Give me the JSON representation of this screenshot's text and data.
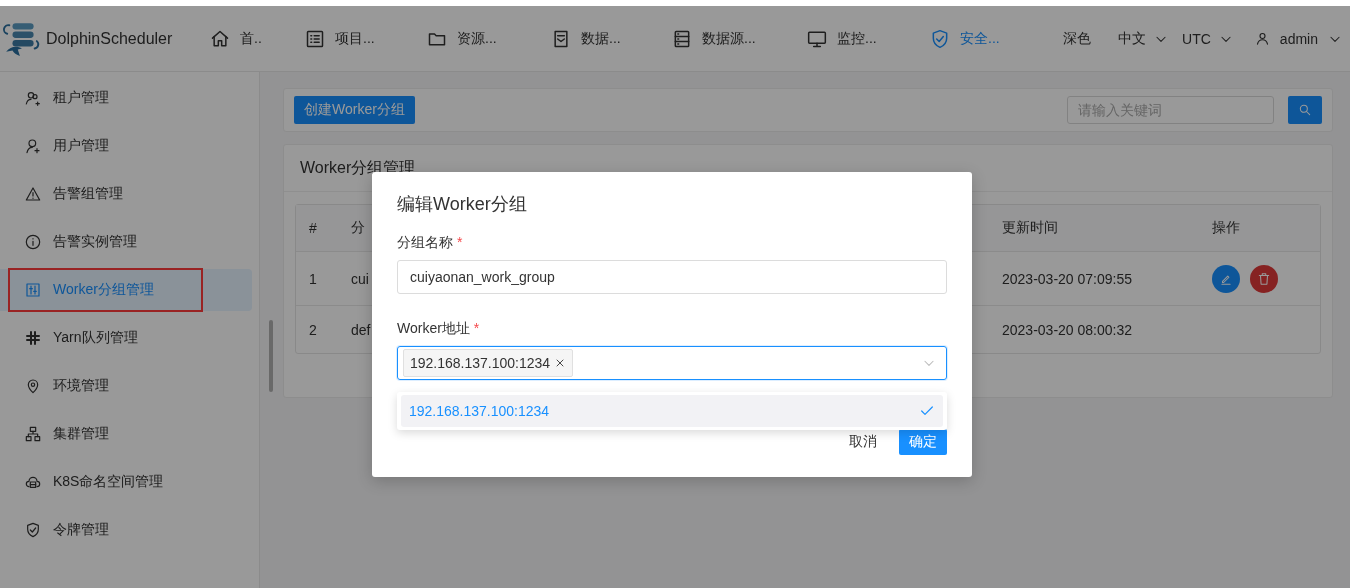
{
  "header": {
    "logo_text": "DolphinScheduler",
    "nav": [
      {
        "label": "首..",
        "selected": false
      },
      {
        "label": "项目...",
        "selected": false
      },
      {
        "label": "资源...",
        "selected": false
      },
      {
        "label": "数据...",
        "selected": false
      },
      {
        "label": "数据源...",
        "selected": false
      },
      {
        "label": "监控...",
        "selected": false
      },
      {
        "label": "安全...",
        "selected": true
      }
    ],
    "theme": "深色",
    "language": "中文",
    "timezone": "UTC",
    "user": "admin"
  },
  "sidebar": {
    "items": [
      {
        "label": "租户管理",
        "selected": false,
        "highlighted": false
      },
      {
        "label": "用户管理",
        "selected": false,
        "highlighted": false
      },
      {
        "label": "告警组管理",
        "selected": false,
        "highlighted": false
      },
      {
        "label": "告警实例管理",
        "selected": false,
        "highlighted": false
      },
      {
        "label": "Worker分组管理",
        "selected": true,
        "highlighted": true
      },
      {
        "label": "Yarn队列管理",
        "selected": false,
        "highlighted": false
      },
      {
        "label": "环境管理",
        "selected": false,
        "highlighted": false
      },
      {
        "label": "集群管理",
        "selected": false,
        "highlighted": false
      },
      {
        "label": "K8S命名空间管理",
        "selected": false,
        "highlighted": false
      },
      {
        "label": "令牌管理",
        "selected": false,
        "highlighted": false
      }
    ]
  },
  "toolbar": {
    "create_button": "创建Worker分组",
    "search": {
      "placeholder": "请输入关键词"
    }
  },
  "panel": {
    "title": "Worker分组管理",
    "table": {
      "columns": [
        "#",
        "分",
        "更新时间",
        "操作"
      ],
      "rows": [
        {
          "cells": [
            "1",
            "cui",
            "2023-03-20 07:09:55"
          ],
          "has_actions": true
        },
        {
          "cells": [
            "2",
            "def",
            "2023-03-20 08:00:32"
          ],
          "has_actions": false
        }
      ]
    }
  },
  "dialog": {
    "title": "编辑Worker分组",
    "fields": [
      {
        "kind": "text",
        "label": "分组名称",
        "required_mark": "*",
        "value": "cuiyaonan_work_group"
      },
      {
        "kind": "multiselect",
        "label": "Worker地址",
        "required_mark": "*",
        "tags": [
          "192.168.137.100:1234"
        ],
        "focused": true,
        "options": [
          {
            "label": "192.168.137.100:1234",
            "selected": true
          }
        ]
      }
    ],
    "buttons": [
      {
        "label": "取消",
        "primary": false
      },
      {
        "label": "确定",
        "primary": true
      }
    ]
  }
}
